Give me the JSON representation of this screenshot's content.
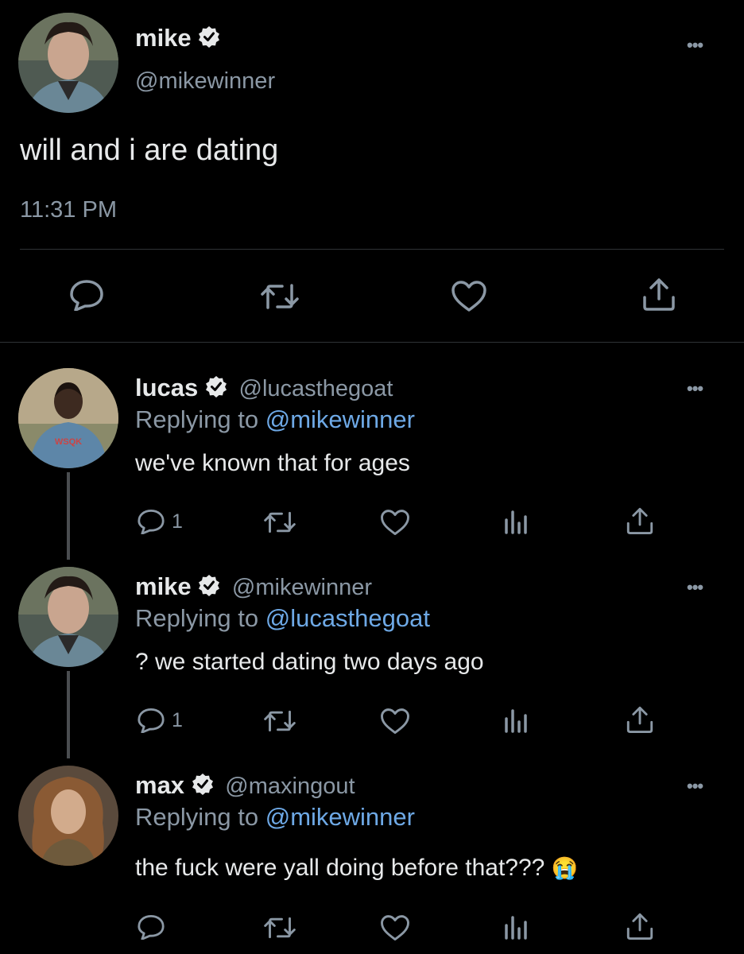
{
  "main_tweet": {
    "name": "mike",
    "handle": "@mikewinner",
    "text": "will and i are dating",
    "time": "11:31 PM"
  },
  "replies": [
    {
      "name": "lucas",
      "handle": "@lucasthegoat",
      "replying_prefix": "Replying to ",
      "replying_to": "@mikewinner",
      "text": "we've known that for ages",
      "reply_count": "1"
    },
    {
      "name": "mike",
      "handle": "@mikewinner",
      "replying_prefix": "Replying to ",
      "replying_to": "@lucasthegoat",
      "text": "? we started dating two days ago",
      "reply_count": "1"
    },
    {
      "name": "max",
      "handle": "@maxingout",
      "replying_prefix": "Replying to ",
      "replying_to": "@mikewinner",
      "text": "the fuck were yall doing before that???",
      "emoji": "😭",
      "reply_count": ""
    }
  ],
  "colors": {
    "background": "#000000",
    "text": "#e7e9ea",
    "muted": "#8b98a5",
    "link": "#6ea9e6",
    "separator": "#2f3336"
  },
  "icons": [
    "verified-badge-icon",
    "more-icon",
    "reply-icon",
    "retweet-icon",
    "like-icon",
    "views-icon",
    "share-icon"
  ]
}
